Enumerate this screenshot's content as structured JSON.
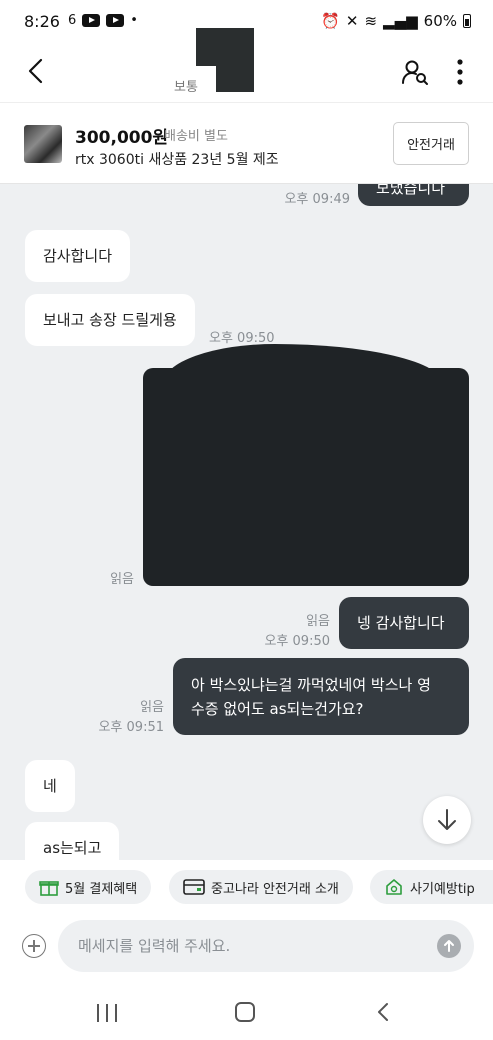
{
  "status_bar": {
    "time": "8:26",
    "battery": "60%"
  },
  "header": {
    "seller_grade": "보통"
  },
  "product": {
    "price": "300,000원",
    "shipping": "배송비 별도",
    "title": "rtx 3060ti 새상품 23년 5월 제조",
    "safe_trade_button": "안전거래"
  },
  "messages": [
    {
      "side": "out",
      "text": "보냈습니다",
      "time": "오후 09:49"
    },
    {
      "side": "in",
      "text": "감사합니다",
      "time": ""
    },
    {
      "side": "in",
      "text": "보내고 송장 드릴게용",
      "time": "오후 09:50"
    },
    {
      "side": "out",
      "type": "photo",
      "read": "읽음",
      "time": ""
    },
    {
      "side": "out",
      "text": "넹 감사합니다",
      "read": "읽음",
      "time": "오후 09:50"
    },
    {
      "side": "out",
      "text_line1": "아 박스있냐는걸 까먹었네여 박스나 영",
      "text_line2": "수증 없어도 as되는건가요?",
      "read": "읽음",
      "time": "오후 09:51"
    },
    {
      "side": "in",
      "text": "네",
      "time": ""
    },
    {
      "side": "in",
      "text": "as는되고",
      "time": ""
    }
  ],
  "chips": [
    {
      "label": "5월 결제혜택",
      "icon": "gift-icon",
      "color": "#2e9e3e"
    },
    {
      "label": "중고나라 안전거래 소개",
      "icon": "card-icon",
      "color": "#2e9e3e"
    },
    {
      "label": "사기예방tip",
      "icon": "shield-home-icon",
      "color": "#2e9e3e"
    }
  ],
  "input": {
    "placeholder": "메세지를 입력해 주세요."
  }
}
